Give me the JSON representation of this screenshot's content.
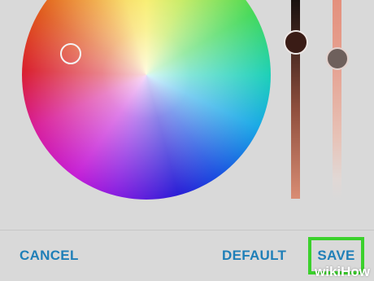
{
  "dialog": {
    "buttons": {
      "cancel_label": "CANCEL",
      "default_label": "DEFAULT",
      "save_label": "SAVE"
    }
  },
  "picker": {
    "brightness_level": 0.8,
    "saturation_level": 0.7
  },
  "colors": {
    "accent": "#1f7fb8",
    "highlight": "#3bd12c",
    "background": "#d9d9d9"
  },
  "watermark": {
    "text_wiki": "wiki",
    "text_how": "How"
  }
}
